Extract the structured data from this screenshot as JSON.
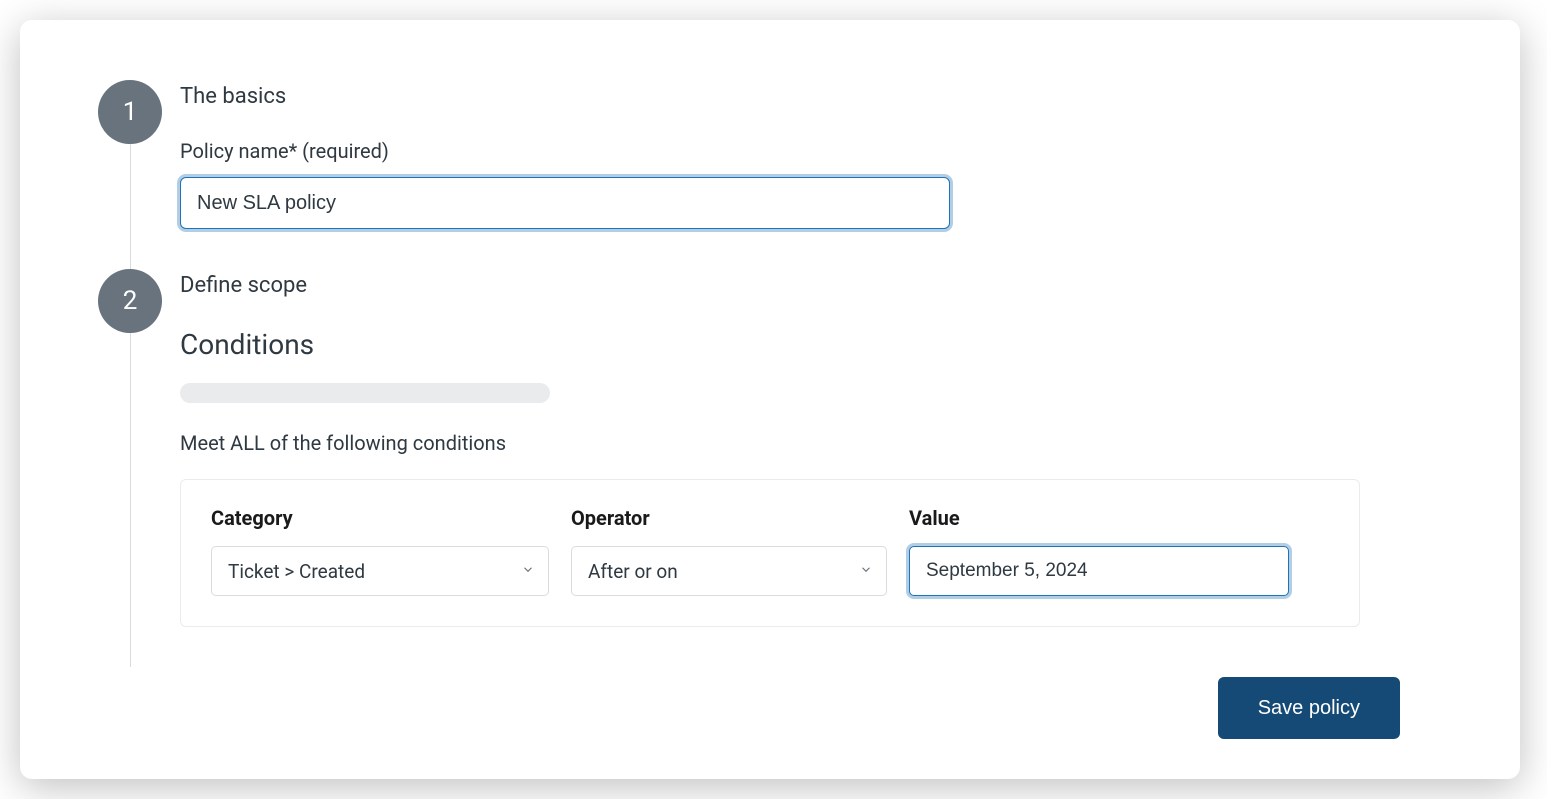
{
  "steps": {
    "basics": {
      "number": "1",
      "title": "The basics",
      "policy_name_label": "Policy name* (required)",
      "policy_name_value": "New SLA policy"
    },
    "scope": {
      "number": "2",
      "title": "Define scope",
      "conditions_heading": "Conditions",
      "meet_all_label": "Meet ALL of the following conditions",
      "columns": {
        "category": "Category",
        "operator": "Operator",
        "value": "Value"
      },
      "row": {
        "category": "Ticket > Created",
        "operator": "After or on",
        "value": "September 5, 2024"
      }
    }
  },
  "actions": {
    "save_label": "Save policy"
  }
}
